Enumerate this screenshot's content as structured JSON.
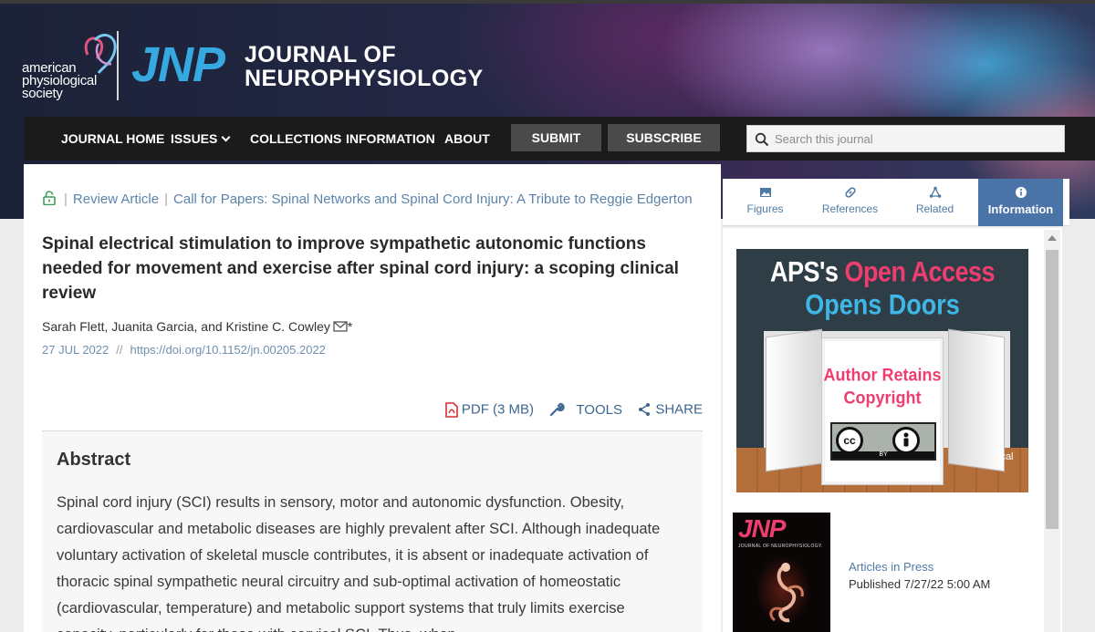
{
  "brand": {
    "aps_lines": [
      "american",
      "physiological",
      "society"
    ],
    "journal_abbrev": "JNP",
    "journal_name_lines": [
      "JOURNAL OF",
      "NEUROPHYSIOLOGY"
    ],
    "colors": {
      "brand_blue": "#35a9e0",
      "accent_pink": "#ee3d6f",
      "link_blue": "#4f7aa5",
      "tab_active": "#4a73a8"
    }
  },
  "nav": {
    "journal_home": "JOURNAL HOME",
    "issues": "ISSUES",
    "collections": "COLLECTIONS",
    "information": "INFORMATION",
    "about": "ABOUT",
    "submit": "SUBMIT",
    "subscribe": "SUBSCRIBE",
    "search_placeholder": "Search this journal"
  },
  "article": {
    "access_icon": "lock-open-icon",
    "type": "Review Article",
    "call": "Call for Papers: Spinal Networks and Spinal Cord Injury: A Tribute to Reggie Edgerton",
    "title": "Spinal electrical stimulation to improve sympathetic autonomic functions needed for movement and exercise after spinal cord injury: a scoping clinical review",
    "authors": "Sarah Flett, Juanita Garcia, and Kristine C. Cowley",
    "corresponding_mark": "*",
    "date": "27 JUL 2022",
    "date_sep": "//",
    "doi": "https://doi.org/10.1152/jn.00205.2022",
    "tools": {
      "pdf": "PDF (3 MB)",
      "tools": "TOOLS",
      "share": "SHARE"
    },
    "abstract_heading": "Abstract",
    "abstract_text": "Spinal cord injury (SCI) results in sensory, motor and autonomic dysfunction. Obesity, cardiovascular and metabolic diseases are highly prevalent after SCI. Although inadequate voluntary activation of skeletal muscle contributes, it is absent or inadequate activation of thoracic spinal sympathetic neural circuitry and sub-optimal activation of homeostatic (cardiovascular, temperature) and metabolic support systems that truly limits exercise capacity, particularly for those with cervical SCI. Thus, when"
  },
  "sidebar": {
    "tabs": [
      {
        "label": "Figures",
        "icon": "image-icon"
      },
      {
        "label": "References",
        "icon": "link-icon"
      },
      {
        "label": "Related",
        "icon": "network-icon"
      },
      {
        "label": "Information",
        "icon": "info-icon"
      }
    ],
    "ad": {
      "line1_a": "APS's ",
      "line1_b": "Open Access",
      "line2": "Opens Doors",
      "author_line1": "Author Retains",
      "author_line2": "Copyright",
      "cc_label": "cc",
      "by_label": "BY",
      "side_fragment": "ical"
    },
    "cover": {
      "abbrev": "JNP",
      "subtitle": "JOURNAL OF NEUROPHYSIOLOGY."
    },
    "press_link": "Articles in Press",
    "press_date": "Published 7/27/22 5:00 AM"
  }
}
